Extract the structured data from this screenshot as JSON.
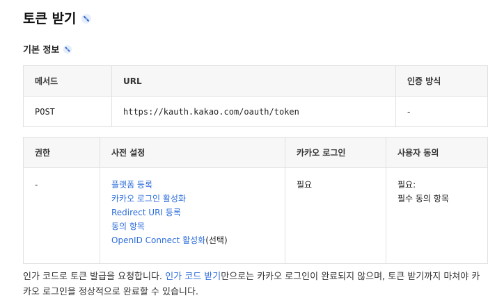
{
  "heading": "토큰 받기",
  "subheading": "기본 정보",
  "table1": {
    "headers": [
      "메서드",
      "URL",
      "인증 방식"
    ],
    "row": [
      "POST",
      "https://kauth.kakao.com/oauth/token",
      "-"
    ]
  },
  "table2": {
    "headers": [
      "권한",
      "사전 설정",
      "카카오 로그인",
      "사용자 동의"
    ],
    "permission": "-",
    "setup_links": [
      "플랫폼 등록",
      "카카오 로그인 활성화",
      "Redirect URI 등록",
      "동의 항목",
      "OpenID Connect 활성화"
    ],
    "setup_suffix": "(선택)",
    "kakao_login": "필요",
    "consent_line1": "필요:",
    "consent_line2": "필수 동의 항목"
  },
  "paragraph": {
    "before": "인가 코드로 토큰 발급을 요청합니다. ",
    "link": "인가 코드 받기",
    "after": "만으로는 카카오 로그인이 완료되지 않으며, 토큰 받기까지 마쳐야 카카오 로그인을 정상적으로 완료할 수 있습니다."
  },
  "colors": {
    "link": "#2d6ddb",
    "header_bg": "#f7f7f8",
    "border": "#e1e1e1"
  }
}
